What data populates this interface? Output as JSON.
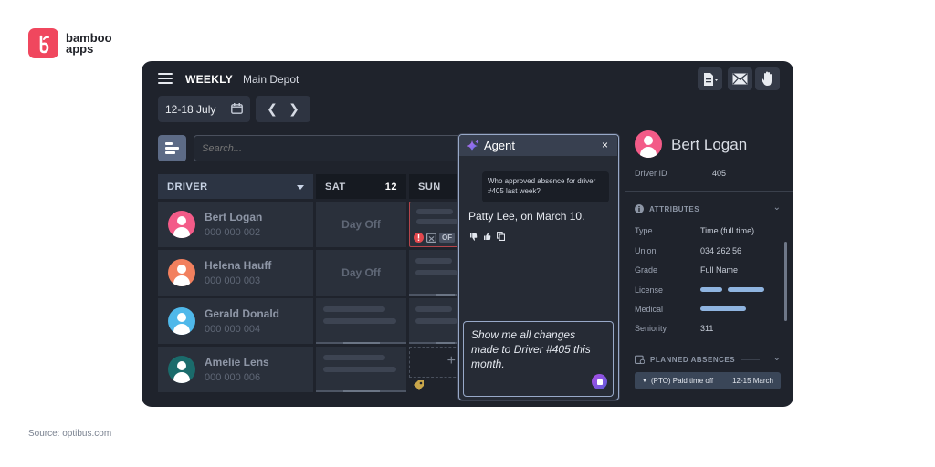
{
  "brand": {
    "name": "bamboo apps",
    "accent": "#f0475e"
  },
  "source": "Source: optibus.com",
  "toolbar": {
    "view": "WEEKLY",
    "depot": "Main Depot",
    "date_range": "12-18 July",
    "icons": [
      "document-icon",
      "mail-icon",
      "hand-icon"
    ]
  },
  "search": {
    "placeholder": "Search..."
  },
  "schedule": {
    "driver_header": "DRIVER",
    "days": [
      {
        "label": "SAT",
        "num": "12"
      },
      {
        "label": "SUN",
        "num": ""
      }
    ],
    "drivers": [
      {
        "name": "Bert Logan",
        "id": "000 000 002",
        "avatar_color": "#f35b88",
        "sat": "Day Off"
      },
      {
        "name": "Helena Hauff",
        "id": "000 000 003",
        "avatar_color": "#f2805e",
        "sat": "Day Off"
      },
      {
        "name": "Gerald Donald",
        "id": "000 000 004",
        "avatar_color": "#4fb8ea",
        "sat": ""
      },
      {
        "name": "Amelie Lens",
        "id": "000 000 006",
        "avatar_color": "#1a6b6b",
        "sat": ""
      }
    ],
    "sun_badge": "OF"
  },
  "agent": {
    "title": "Agent",
    "close": "×",
    "user_question": "Who approved absence for driver #405 last week?",
    "answer": "Patty Lee, on March 10.",
    "input_text": "Show me all changes made to Driver #405 this month."
  },
  "profile": {
    "name": "Bert Logan",
    "driver_id_label": "Driver ID",
    "driver_id": "405",
    "attributes_label": "ATTRIBUTES",
    "attributes": [
      {
        "label": "Type",
        "value": "Time (full time)"
      },
      {
        "label": "Union",
        "value": "034 262 56"
      },
      {
        "label": "Grade",
        "value": "Full Name"
      },
      {
        "label": "License",
        "value": ""
      },
      {
        "label": "Medical",
        "value": ""
      },
      {
        "label": "Seniority",
        "value": "311"
      }
    ],
    "absences_label": "PLANNED ABSENCES",
    "absence": {
      "label": "(PTO) Paid time off",
      "dates": "12-15 March"
    }
  }
}
